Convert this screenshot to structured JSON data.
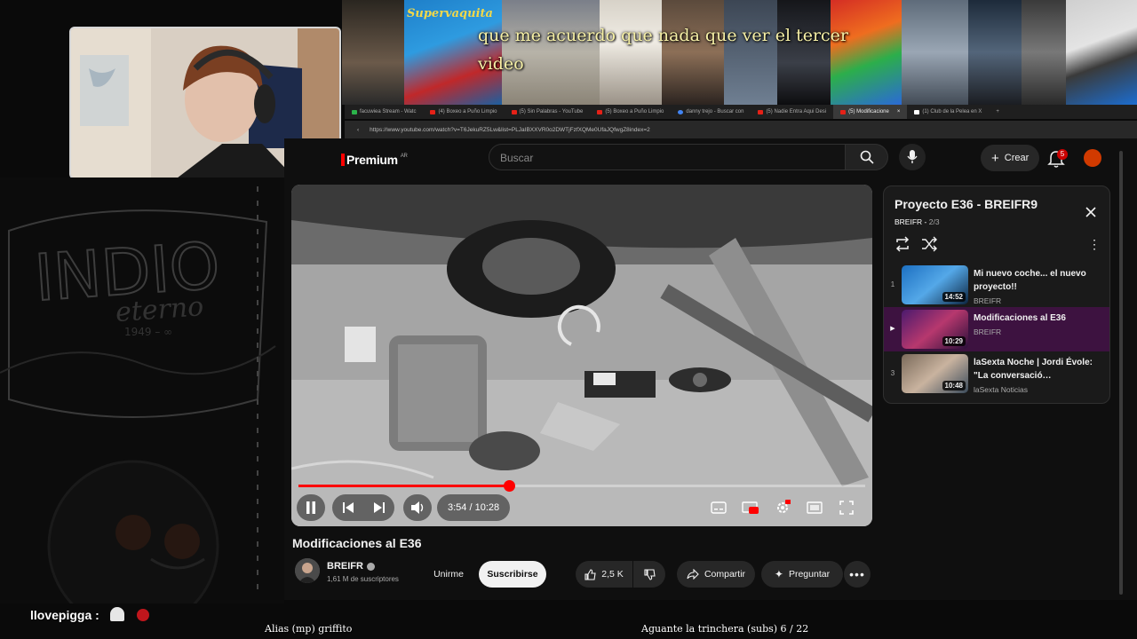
{
  "stream": {
    "caption": "que me acuerdo que nada que ver el tercer video",
    "movie_title": "Supervaquita",
    "chat_user": "llovepigga :",
    "now_playing": "Alias (mp) griffito",
    "counter": "Aguante la trinchera (subs) 6 / 22",
    "art_word": "INDIO",
    "art_sub": "eterno"
  },
  "browser": {
    "tabs": [
      {
        "label": "facuwiea Stream - Watc",
        "active": false
      },
      {
        "label": "(4) Boxeo a Puño Limpio",
        "active": false
      },
      {
        "label": "(5) Sin Palabras - YouTube",
        "active": false
      },
      {
        "label": "(5) Boxeo a Puño Limpio",
        "active": false
      },
      {
        "label": "danny trejo - Buscar con",
        "active": false
      },
      {
        "label": "(5) Nadie Entra Aqui Desi",
        "active": false
      },
      {
        "label": "(5) Modificacione",
        "active": true
      },
      {
        "label": "(1) Club de la Pelea en X",
        "active": false
      }
    ],
    "url": "https://www.youtube.com/watch?v=T6JekuRZ5Lw&list=PLJaIBXXVR0o2DWTjFzfXQMe0UfaJQfwgZ8index=2"
  },
  "youtube": {
    "logo": "Premium",
    "region": "AR",
    "search_placeholder": "Buscar",
    "create_label": "Crear",
    "notifications": "5",
    "player": {
      "current_time": "3:54",
      "duration": "10:28",
      "time_display": "3:54 / 10:28",
      "progress": 0.372
    },
    "video": {
      "title": "Modificaciones al E36",
      "channel": "BREIFR",
      "subscribers": "1,61 M de suscriptores",
      "join_label": "Unirme",
      "subscribe_label": "Suscribirse",
      "likes": "2,5 K",
      "share_label": "Compartir",
      "ask_label": "Preguntar"
    },
    "playlist": {
      "title": "Proyecto E36 - BREIFR9",
      "owner": "BREIFR",
      "position": "2/3",
      "items": [
        {
          "index": "1",
          "title": "Mi nuevo coche... el nuevo proyecto!!",
          "channel": "BREIFR",
          "duration": "14:52",
          "active": false
        },
        {
          "index": "▶",
          "title": "Modificaciones al E36",
          "channel": "BREIFR",
          "duration": "10:29",
          "active": true
        },
        {
          "index": "3",
          "title": "laSexta Noche | Jordi Évole: \"La conversació…",
          "channel": "laSexta Noticias",
          "duration": "10:48",
          "active": false
        }
      ]
    }
  },
  "colors": {
    "accent": "#ff0000",
    "active_item": "#3d1240",
    "caption": "#f6f0a6"
  }
}
